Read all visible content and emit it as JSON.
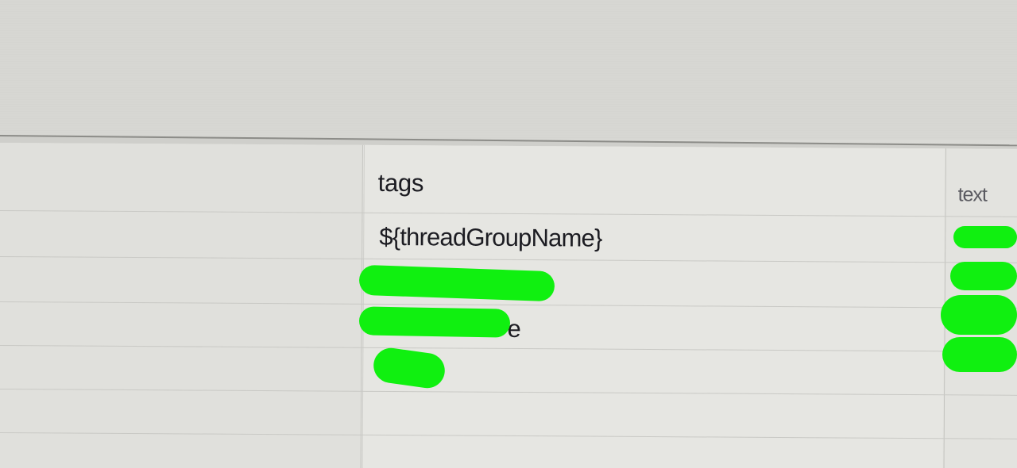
{
  "table": {
    "headers": {
      "main_column": "tags",
      "right_column": "text"
    },
    "rows": [
      {
        "main": "${threadGroupName}"
      },
      {
        "main": ""
      },
      {
        "main": "e"
      },
      {
        "main": ""
      }
    ]
  },
  "colors": {
    "redaction": "#10f010",
    "text": "#1c1c22",
    "background": "#e2e2de"
  }
}
